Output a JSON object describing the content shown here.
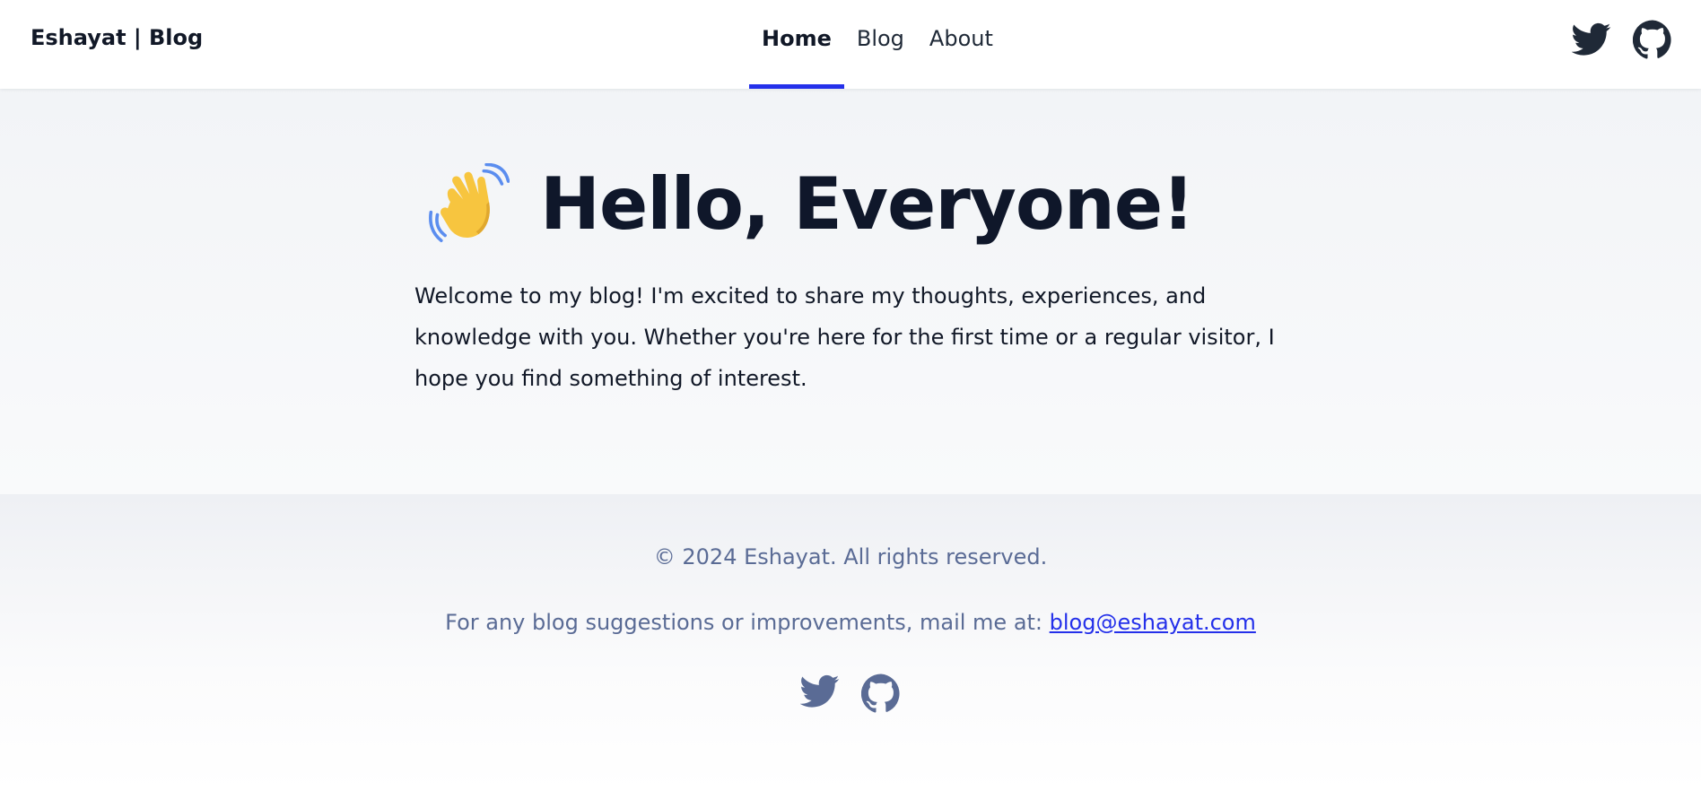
{
  "header": {
    "brand": "Eshayat | Blog",
    "nav": [
      {
        "label": "Home",
        "active": true
      },
      {
        "label": "Blog",
        "active": false
      },
      {
        "label": "About",
        "active": false
      }
    ],
    "icons": [
      "twitter-icon",
      "github-icon"
    ]
  },
  "hero": {
    "emoji": "waving-hand-icon",
    "title": "Hello, Everyone!",
    "text": "Welcome to my blog! I'm excited to share my thoughts, experiences, and knowledge with you. Whether you're here for the first time or a regular visitor, I hope you find something of interest."
  },
  "footer": {
    "copyright": "© 2024 Eshayat. All rights reserved.",
    "suggestion_prefix": "For any blog suggestions or improvements, mail me at: ",
    "email": "blog@eshayat.com",
    "icons": [
      "twitter-icon",
      "github-icon"
    ]
  },
  "colors": {
    "accent": "#2430ea",
    "heading": "#0f172a",
    "footer_text": "#5a6b95",
    "header_icon": "#1f2937",
    "footer_icon": "#5a6b95"
  }
}
